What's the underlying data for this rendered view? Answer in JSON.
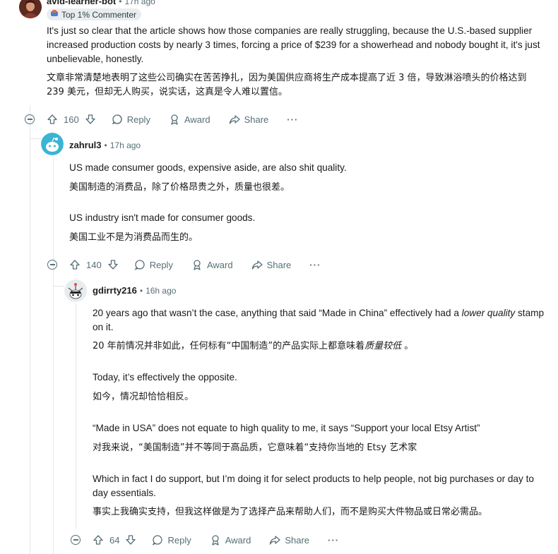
{
  "comment1": {
    "username": "avid-learner-bot",
    "time": "17h ago",
    "badge": "Top 1% Commenter",
    "text_en": "It's just so clear that the article shows how those companies are really struggling, because the U.S.-based supplier increased production costs by nearly 3 times, forcing a price of $239 for a showerhead and nobody bought it, it's just unbelievable, honestly.",
    "text_zh": "文章非常清楚地表明了这些公司确实在苦苦挣扎，因为美国供应商将生产成本提高了近 3 倍，导致淋浴喷头的价格达到 239 美元，但却无人购买，说实话，这真是令人难以置信。",
    "votes": "160"
  },
  "comment2": {
    "username": "zahrul3",
    "time": "17h ago",
    "p1_en": "US made consumer goods, expensive aside, are also shit quality.",
    "p1_zh": "美国制造的消费品，除了价格昂贵之外，质量也很差。",
    "p2_en": "US industry isn't made for consumer goods.",
    "p2_zh": "美国工业不是为消费品而生的。",
    "votes": "140"
  },
  "comment3": {
    "username": "gdirrty216",
    "time": "16h ago",
    "p1_en_a": "20 years ago that wasn’t the case, anything that said “Made in China” effectively had a ",
    "p1_en_em": "lower quality",
    "p1_en_b": " stamp on it.",
    "p1_zh_a": "20 年前情况并非如此，任何标有“中国制造”的产品实际上都意味着",
    "p1_zh_em": "质量较低",
    "p1_zh_b": " 。",
    "p2_en": "Today, it’s effectively the opposite.",
    "p2_zh": "如今，情况却恰恰相反。",
    "p3_en": "“Made in USA” does not equate to high quality to me, it says “Support your local Etsy Artist”",
    "p3_zh": "对我来说，“美国制造”并不等同于高品质，它意味着“支持你当地的 Etsy 艺术家",
    "p4_en": "Which in fact I do support, but I’m doing it for select products to help people, not big purchases or day to day essentials.",
    "p4_zh": "事实上我确实支持，但我这样做是为了选择产品来帮助人们，而不是购买大件物品或日常必需品。",
    "votes": "64"
  },
  "actions": {
    "reply": "Reply",
    "award": "Award",
    "share": "Share",
    "more": "···"
  },
  "icons": [
    "collapse-icon",
    "upvote-icon",
    "downvote-icon",
    "reply-icon",
    "award-icon",
    "share-icon",
    "more-icon",
    "badge-icon"
  ],
  "colors": {
    "text": "#1a1a1b",
    "meta": "#576f76",
    "thread_line": "#e4e6e8",
    "badge_bg": "#eaedef",
    "avatar2": "#3ab4d4"
  }
}
